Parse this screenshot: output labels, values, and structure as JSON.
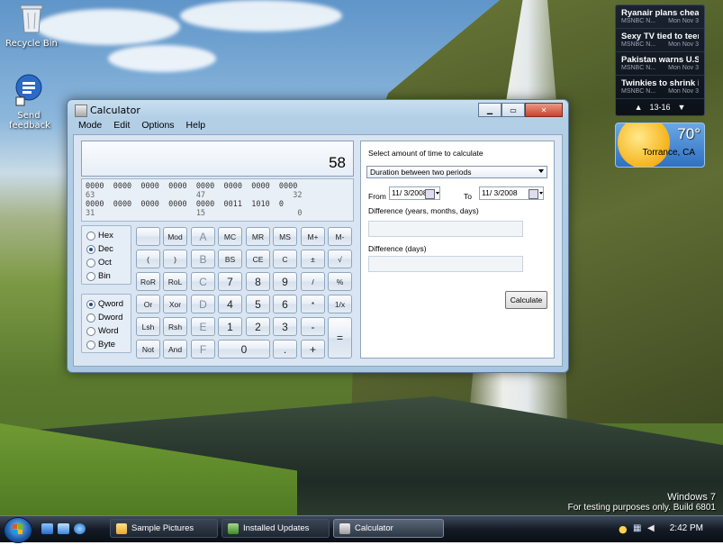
{
  "desktop": {
    "icons": [
      {
        "label": "Recycle Bin"
      },
      {
        "label": "Send feedback"
      }
    ],
    "watermark": {
      "line1": "Windows 7",
      "line2": "For testing purposes only. Build 6801"
    }
  },
  "news_gadget": {
    "items": [
      {
        "title": "Ryanair plans cheap ...",
        "source": "MSNBC N...",
        "date": "Mon Nov 3"
      },
      {
        "title": "Sexy TV tied to teen ...",
        "source": "MSNBC N...",
        "date": "Mon Nov 3"
      },
      {
        "title": "Pakistan warns U.S. ...",
        "source": "MSNBC N...",
        "date": "Mon Nov 3"
      },
      {
        "title": "Twinkies to shrink in ...",
        "source": "MSNBC N...",
        "date": "Mon Nov 3"
      }
    ],
    "page": "13-16",
    "prev": "▲",
    "next": "▼"
  },
  "weather_gadget": {
    "temp": "70°",
    "city": "Torrance, CA"
  },
  "calculator": {
    "title": "Calculator",
    "menu": [
      "Mode",
      "Edit",
      "Options",
      "Help"
    ],
    "display": "58",
    "bits": {
      "row1": "0000  0000  0000  0000  0000  0000  0000  0000",
      "row2": "63                      47                   32",
      "row3": "0000  0000  0000  0000  0000  0011  1010  0",
      "row4": "31                      15                    0"
    },
    "bases": [
      {
        "label": "Hex",
        "selected": false
      },
      {
        "label": "Dec",
        "selected": true
      },
      {
        "label": "Oct",
        "selected": false
      },
      {
        "label": "Bin",
        "selected": false
      }
    ],
    "word_sizes": [
      {
        "label": "Qword",
        "selected": true
      },
      {
        "label": "Dword",
        "selected": false
      },
      {
        "label": "Word",
        "selected": false
      },
      {
        "label": "Byte",
        "selected": false
      }
    ],
    "keys": [
      [
        "",
        "Mod",
        "A",
        "MC",
        "MR",
        "MS",
        "M+",
        "M-"
      ],
      [
        "(",
        ")",
        "B",
        "BS",
        "CE",
        "C",
        "±",
        "√"
      ],
      [
        "RoR",
        "RoL",
        "C",
        "7",
        "8",
        "9",
        "/",
        "%"
      ],
      [
        "Or",
        "Xor",
        "D",
        "4",
        "5",
        "6",
        "*",
        "1/x"
      ],
      [
        "Lsh",
        "Rsh",
        "E",
        "1",
        "2",
        "3",
        "-",
        ""
      ],
      [
        "Not",
        "And",
        "F",
        "0",
        "",
        ".",
        "+",
        "="
      ]
    ],
    "date_panel": {
      "heading": "Select amount of time to calculate",
      "mode": "Duration between two periods",
      "from_label": "From",
      "from_value": "11/ 3/2008",
      "to_label": "To",
      "to_value": "11/ 3/2008",
      "diff_ymd_label": "Difference (years, months, days)",
      "diff_days_label": "Difference (days)",
      "calculate_label": "Calculate"
    }
  },
  "taskbar": {
    "buttons": [
      {
        "label": "Sample Pictures"
      },
      {
        "label": "Installed Updates"
      },
      {
        "label": "Calculator"
      }
    ],
    "clock": "2:42 PM"
  }
}
